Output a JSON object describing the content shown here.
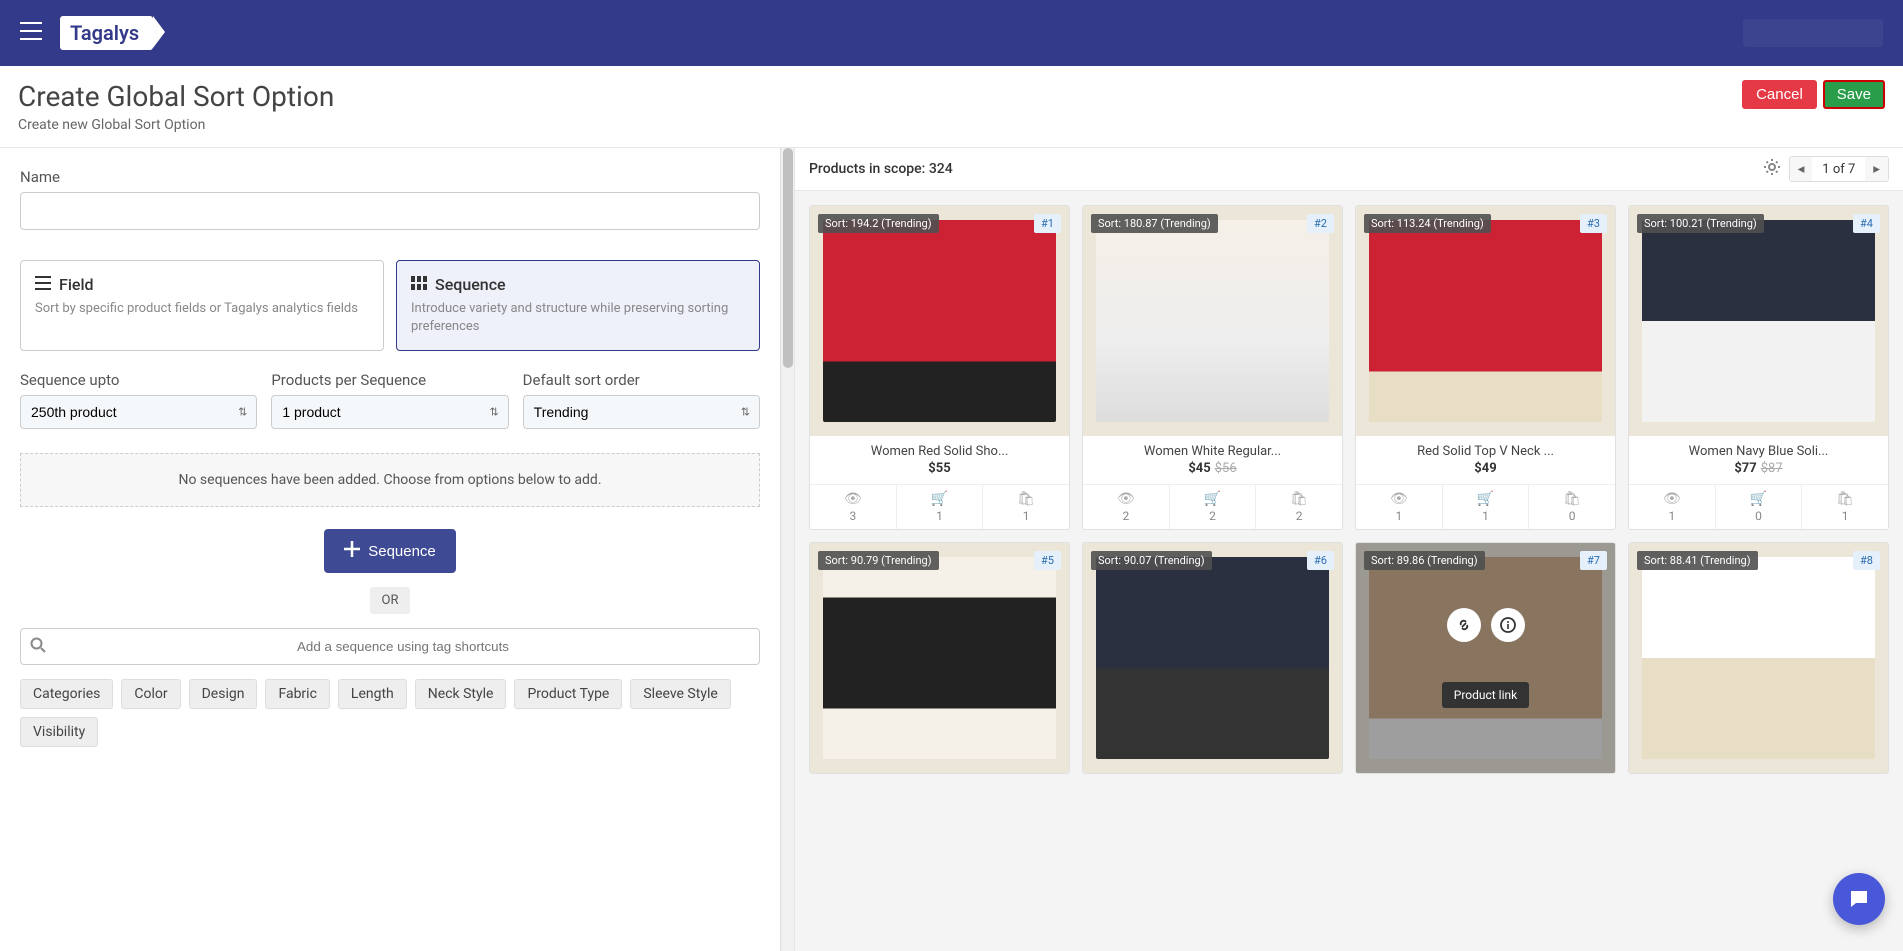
{
  "header": {
    "logo": "Tagalys"
  },
  "page": {
    "title": "Create Global Sort Option",
    "subtitle": "Create new Global Sort Option",
    "cancel": "Cancel",
    "save": "Save"
  },
  "form": {
    "name_label": "Name",
    "field_card": {
      "title": "Field",
      "desc": "Sort by specific product fields or Tagalys analytics fields"
    },
    "sequence_card": {
      "title": "Sequence",
      "desc": "Introduce variety and structure while preserving sorting preferences"
    },
    "seq_upto_label": "Sequence upto",
    "seq_upto_value": "250th product",
    "per_seq_label": "Products per Sequence",
    "per_seq_value": "1 product",
    "default_sort_label": "Default sort order",
    "default_sort_value": "Trending",
    "empty_msg": "No sequences have been added. Choose from options below to add.",
    "add_seq": "Sequence",
    "or": "OR",
    "search_placeholder": "Add a sequence using tag shortcuts",
    "tags": [
      "Categories",
      "Color",
      "Design",
      "Fabric",
      "Length",
      "Neck Style",
      "Product Type",
      "Sleeve Style",
      "Visibility"
    ]
  },
  "right": {
    "scope_label": "Products in scope: ",
    "scope_count": "324",
    "page_text": "1 of 7"
  },
  "products": [
    {
      "sort": "Sort: 194.2 (Trending)",
      "rank": "#1",
      "name": "Women Red Solid Sho...",
      "price": "$55",
      "orig": "",
      "views": "3",
      "carts": "1",
      "buys": "1",
      "fig": "fig1"
    },
    {
      "sort": "Sort: 180.87 (Trending)",
      "rank": "#2",
      "name": "Women White Regular...",
      "price": "$45",
      "orig": "$56",
      "views": "2",
      "carts": "2",
      "buys": "2",
      "fig": "fig2"
    },
    {
      "sort": "Sort: 113.24 (Trending)",
      "rank": "#3",
      "name": "Red Solid Top V Neck ...",
      "price": "$49",
      "orig": "",
      "views": "1",
      "carts": "1",
      "buys": "0",
      "fig": "fig3"
    },
    {
      "sort": "Sort: 100.21 (Trending)",
      "rank": "#4",
      "name": "Women Navy Blue Soli...",
      "price": "$77",
      "orig": "$87",
      "views": "1",
      "carts": "0",
      "buys": "1",
      "fig": "fig4"
    },
    {
      "sort": "Sort: 90.79 (Trending)",
      "rank": "#5",
      "name": "",
      "price": "",
      "orig": "",
      "views": "",
      "carts": "",
      "buys": "",
      "fig": "fig5"
    },
    {
      "sort": "Sort: 90.07 (Trending)",
      "rank": "#6",
      "name": "",
      "price": "",
      "orig": "",
      "views": "",
      "carts": "",
      "buys": "",
      "fig": "fig6"
    },
    {
      "sort": "Sort: 89.86 (Trending)",
      "rank": "#7",
      "name": "",
      "price": "",
      "orig": "",
      "views": "",
      "carts": "",
      "buys": "",
      "fig": "fig7",
      "hover": true
    },
    {
      "sort": "Sort: 88.41 (Trending)",
      "rank": "#8",
      "name": "",
      "price": "",
      "orig": "",
      "views": "",
      "carts": "",
      "buys": "",
      "fig": "fig8"
    }
  ],
  "tooltip": "Product link"
}
